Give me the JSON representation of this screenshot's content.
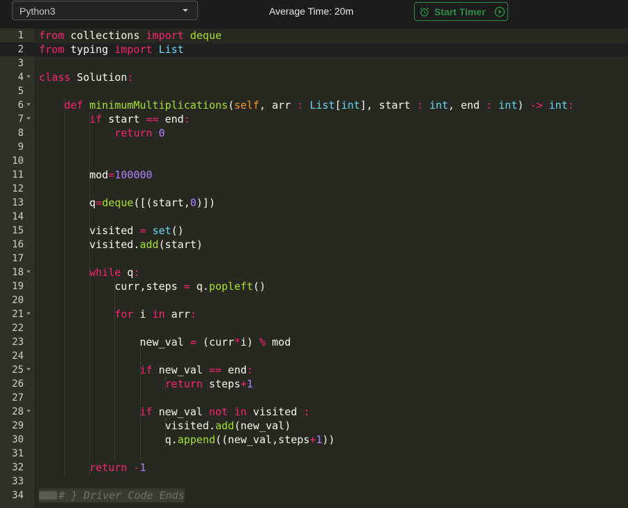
{
  "toolbar": {
    "language": "Python3",
    "average_time": "Average Time: 20m",
    "timer_label": "Start Timer"
  },
  "colors": {
    "keyword": "#f92672",
    "function": "#a6e22e",
    "builtin": "#66d9ef",
    "number": "#ae81ff",
    "timer_accent": "#2f8d46",
    "background": "#272822"
  },
  "icons": {
    "language_caret": "chevron-down-icon",
    "timer_left": "alarm-clock-icon",
    "timer_right": "play-circle-icon",
    "fold": "fold-arrow-icon",
    "collapsed_fold": "collapsed-fold-icon"
  },
  "editor": {
    "line_numbers": [
      "1",
      "2",
      "3",
      "4",
      "5",
      "6",
      "7",
      "8",
      "9",
      "10",
      "11",
      "12",
      "13",
      "14",
      "15",
      "16",
      "17",
      "18",
      "19",
      "20",
      "21",
      "22",
      "23",
      "24",
      "25",
      "26",
      "27",
      "28",
      "29",
      "30",
      "31",
      "32",
      "33",
      "34"
    ],
    "fold_lines": [
      4,
      6,
      7,
      18,
      21,
      25,
      28
    ],
    "active_line": 2,
    "code_lines": [
      "from collections import deque",
      "from typing import List",
      "",
      "class Solution:",
      "",
      "    def minimumMultiplications(self, arr : List[int], start : int, end : int) -> int:",
      "        if start == end:",
      "            return 0",
      "",
      "",
      "        mod=100000",
      "",
      "        q=deque([(start,0)])",
      "",
      "        visited = set()",
      "        visited.add(start)",
      "",
      "        while q:",
      "            curr,steps = q.popleft()",
      "",
      "            for i in arr:",
      "",
      "                new_val = (curr*i) % mod",
      "",
      "                if new_val == end:",
      "                    return steps+1",
      "",
      "                if new_val not in visited :",
      "                    visited.add(new_val)",
      "                    q.append((new_val,steps+1))",
      "",
      "        return -1",
      "",
      "# } Driver Code Ends"
    ]
  }
}
